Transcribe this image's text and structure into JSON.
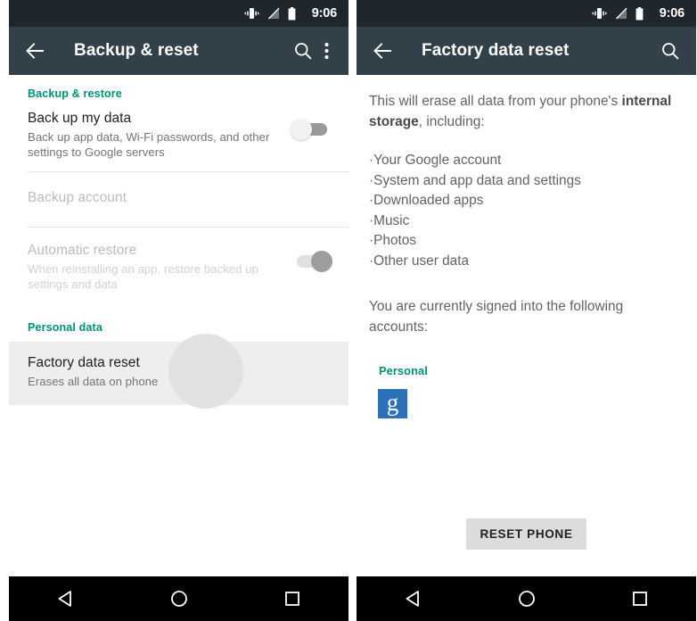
{
  "colors": {
    "statusbar_bg": "#20272c",
    "toolbar_bg": "#32404a",
    "accent_teal": "#009178",
    "navbar_bg": "#000000",
    "google_blue": "#2c70b8",
    "button_bg": "#dcdcdc",
    "pressed_row_bg": "#eeeeee"
  },
  "left": {
    "statusbar": {
      "time": "9:06",
      "icons": [
        "vibrate-icon",
        "no-signal-icon",
        "battery-icon"
      ]
    },
    "toolbar": {
      "back_icon": "back-arrow-icon",
      "title": "Backup & reset",
      "search_icon": "search-icon",
      "overflow_icon": "overflow-menu-icon"
    },
    "sections": [
      {
        "heading": "Backup & restore",
        "rows": [
          {
            "title": "Back up my data",
            "subtitle": "Back up app data, Wi-Fi passwords, and other settings to Google servers",
            "switch_state": "off",
            "enabled": true
          },
          {
            "title": "Backup account",
            "subtitle": "",
            "switch_state": "none",
            "enabled": false
          },
          {
            "title": "Automatic restore",
            "subtitle": "When reinstalling an app, restore backed up settings and data",
            "switch_state": "on",
            "enabled": false
          }
        ]
      },
      {
        "heading": "Personal data",
        "rows": [
          {
            "title": "Factory data reset",
            "subtitle": "Erases all data on phone",
            "switch_state": "none",
            "enabled": true,
            "pressed": true
          }
        ]
      }
    ],
    "navbar": {
      "back": "nav-back-icon",
      "home": "nav-home-icon",
      "recents": "nav-recents-icon"
    }
  },
  "right": {
    "statusbar": {
      "time": "9:06",
      "icons": [
        "vibrate-icon",
        "no-signal-icon",
        "battery-icon"
      ]
    },
    "toolbar": {
      "back_icon": "back-arrow-icon",
      "title": "Factory data reset",
      "search_icon": "search-icon"
    },
    "warning": {
      "lead": "This will erase all data from your phone's ",
      "emphasis": "internal storage",
      "trail": ", including:",
      "items": [
        "·Your Google account",
        "·System and app data and settings",
        "·Downloaded apps",
        "·Music",
        "·Photos",
        "·Other user data"
      ]
    },
    "accounts": {
      "intro": "You are currently signed into the following accounts:",
      "group_label": "Personal",
      "items": [
        {
          "icon": "google-logo-icon",
          "glyph": "g"
        }
      ]
    },
    "action": {
      "reset_label": "RESET PHONE"
    },
    "navbar": {
      "back": "nav-back-icon",
      "home": "nav-home-icon",
      "recents": "nav-recents-icon"
    }
  }
}
